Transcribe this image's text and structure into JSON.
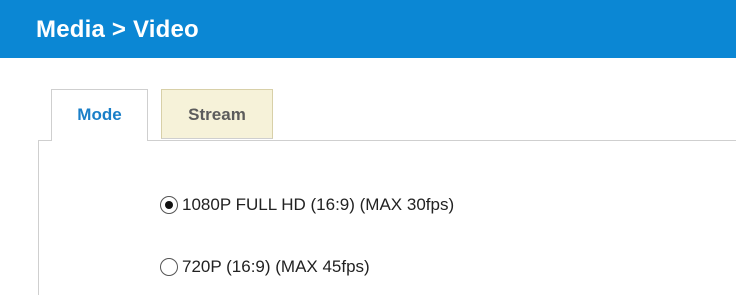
{
  "header": {
    "title": "Media > Video",
    "background_color": "#0b87d4"
  },
  "tabs": [
    {
      "label": "Mode",
      "selected": true
    },
    {
      "label": "Stream",
      "selected": false
    }
  ],
  "mode_options": [
    {
      "label": "1080P FULL HD (16:9) (MAX 30fps)",
      "checked": true
    },
    {
      "label": "720P (16:9) (MAX 45fps)",
      "checked": false
    }
  ],
  "colors": {
    "accent": "#1a7fc8",
    "inactive_tab_bg": "#f6f2d9"
  }
}
